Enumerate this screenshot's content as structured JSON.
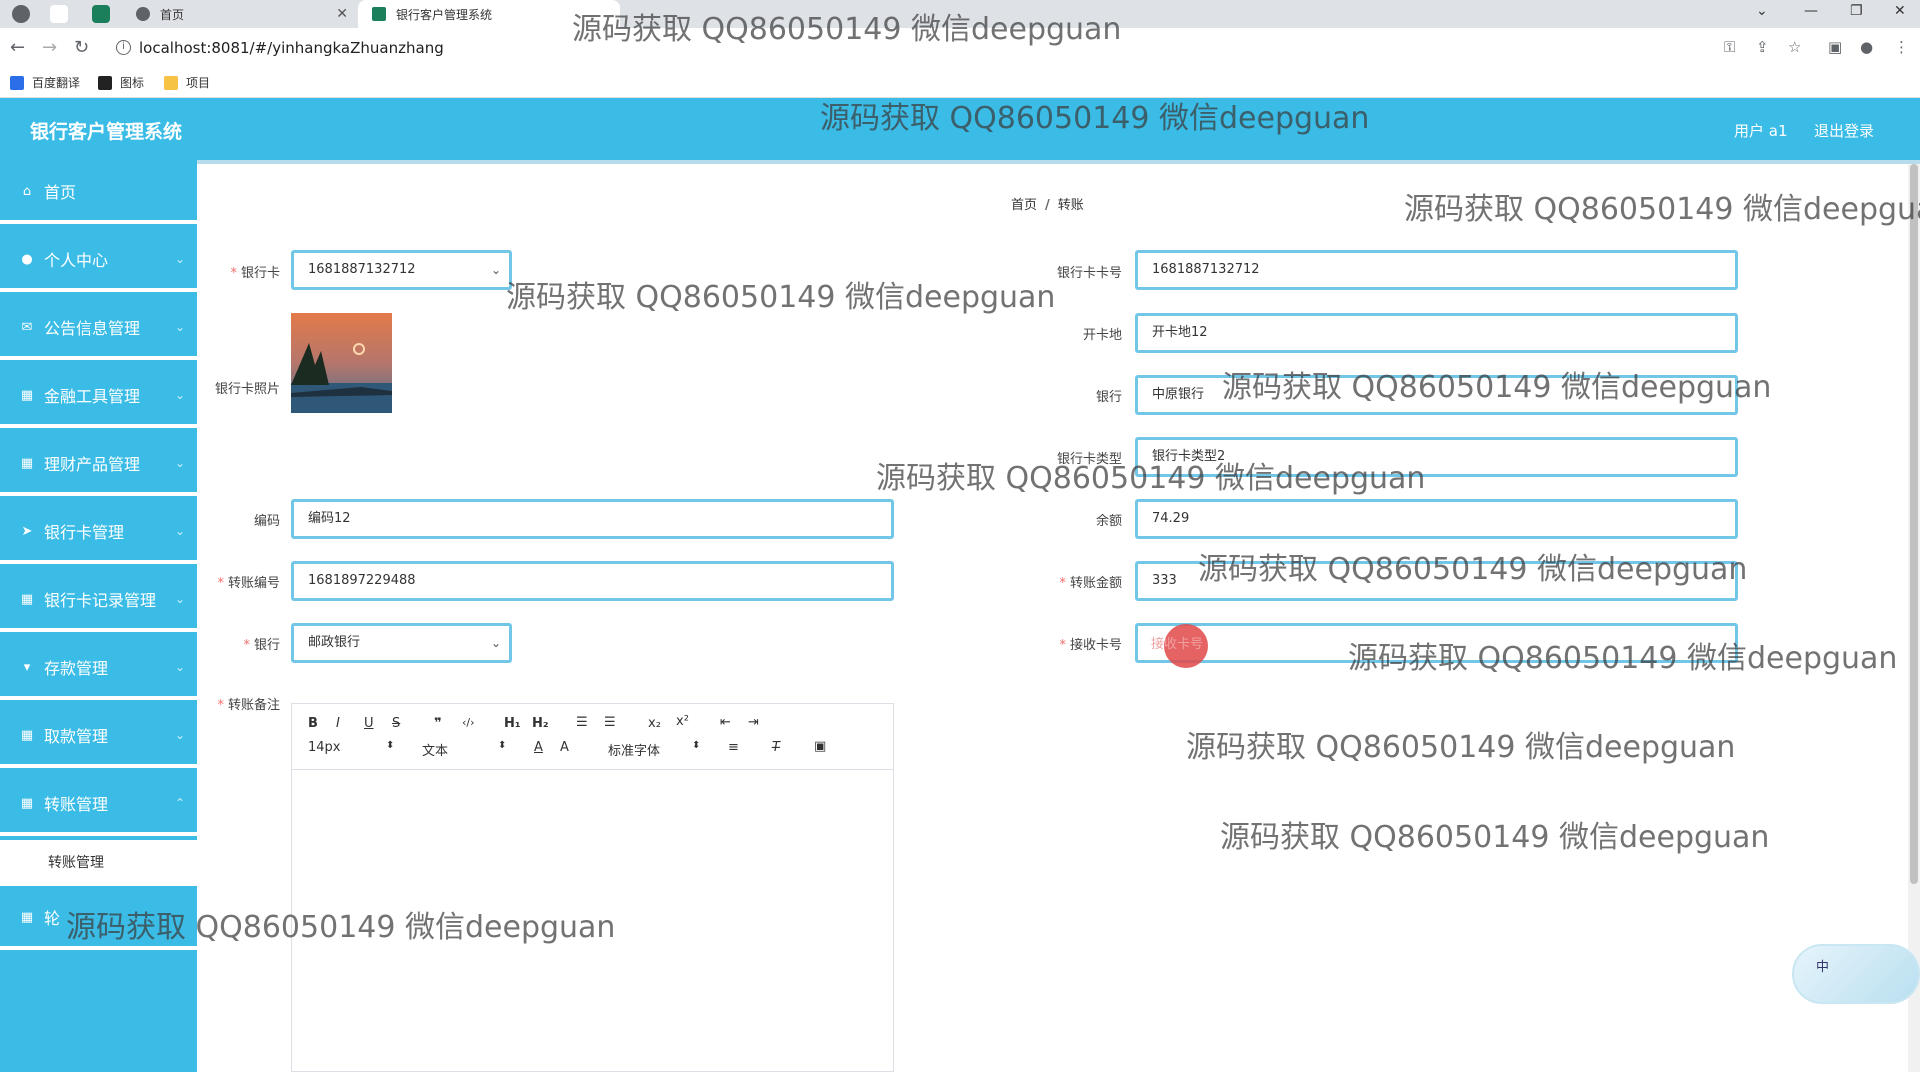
{
  "browser": {
    "tabs": [
      {
        "title": "首页"
      },
      {
        "title": "银行客户管理系统"
      }
    ],
    "url": "localhost:8081/#/yinhangkaZhuanzhang",
    "bookmarks": [
      "百度翻译",
      "图标",
      "项目"
    ]
  },
  "app": {
    "title": "银行客户管理系统",
    "user_label": "用户 a1",
    "logout_label": "退出登录"
  },
  "sidebar": {
    "items": [
      {
        "label": "首页",
        "icon": "home-icon"
      },
      {
        "label": "个人中心",
        "icon": "user-icon"
      },
      {
        "label": "公告信息管理",
        "icon": "envelope-icon"
      },
      {
        "label": "金融工具管理",
        "icon": "grid-icon"
      },
      {
        "label": "理财产品管理",
        "icon": "grid-icon"
      },
      {
        "label": "银行卡管理",
        "icon": "send-icon"
      },
      {
        "label": "银行卡记录管理",
        "icon": "grid-icon"
      },
      {
        "label": "存款管理",
        "icon": "pin-icon"
      },
      {
        "label": "取款管理",
        "icon": "grid-icon"
      },
      {
        "label": "转账管理",
        "icon": "grid-icon"
      },
      {
        "label": "轮",
        "icon": "grid-icon"
      }
    ],
    "active_sub": "转账管理"
  },
  "breadcrumb": {
    "home": "首页",
    "current": "转账"
  },
  "form": {
    "left": {
      "card_label": "银行卡",
      "card_value": "1681887132712",
      "photo_label": "银行卡照片",
      "code_label": "编码",
      "code_value": "编码12",
      "transfer_no_label": "转账编号",
      "transfer_no_value": "1681897229488",
      "bank_label": "银行",
      "bank_value": "邮政银行",
      "remark_label": "转账备注"
    },
    "right": {
      "card_no_label": "银行卡卡号",
      "card_no_value": "1681887132712",
      "open_place_label": "开卡地",
      "open_place_value": "开卡地12",
      "bank_label": "银行",
      "bank_value": "中原银行",
      "card_type_label": "银行卡类型",
      "card_type_value": "银行卡类型2",
      "balance_label": "余额",
      "balance_value": "74.29",
      "amount_label": "转账金额",
      "amount_value": "333",
      "receive_label": "接收卡号",
      "receive_placeholder": "接收卡号"
    }
  },
  "editor": {
    "font_size": "14px",
    "block_type": "文本",
    "font_family": "标准字体",
    "buttons": [
      "B",
      "I",
      "U",
      "S",
      "99",
      "‹/›",
      "H1",
      "H2",
      "≡",
      "≡",
      "x₂",
      "x²",
      "⇤",
      "⇥"
    ]
  },
  "float_widget": {
    "label": "中"
  },
  "watermark": "源码获取 QQ86050149 微信deepguan",
  "colors": {
    "primary": "#3bbce6",
    "field_border": "#72c7e8",
    "required": "#f56c6c"
  }
}
